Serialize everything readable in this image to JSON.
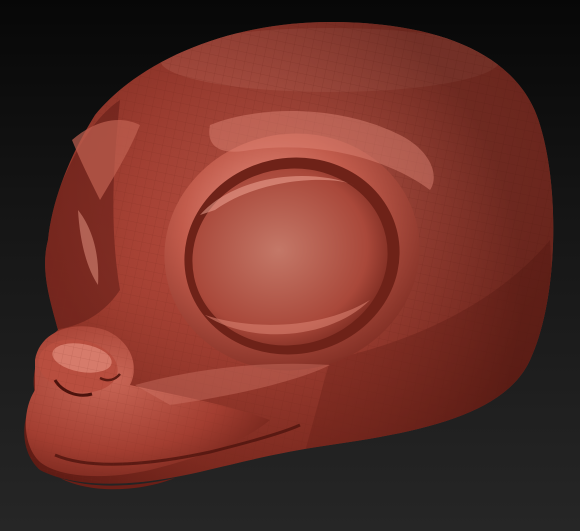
{
  "scene": {
    "subject": "head-sculpt",
    "colors": {
      "background_top": "#070707",
      "background_bottom": "#262626",
      "clay_base": "#b2483a",
      "clay_light": "#e88b7b",
      "clay_dark": "#5c1a13",
      "wireframe": "#7a2a20"
    }
  }
}
